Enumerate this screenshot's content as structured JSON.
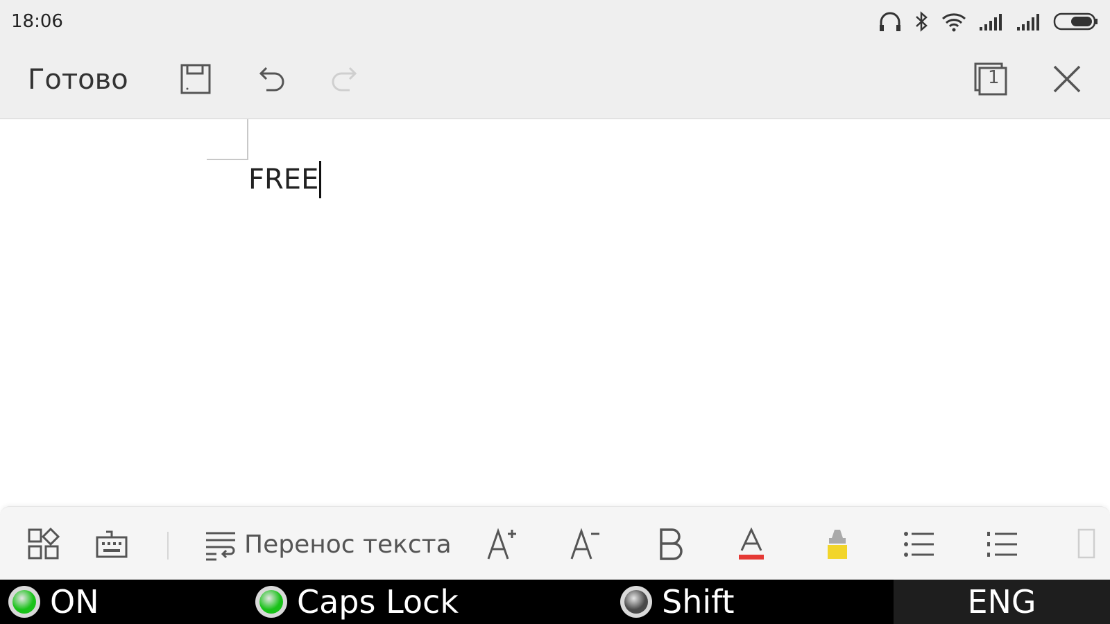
{
  "status_bar": {
    "time": "18:06",
    "icons": [
      "headphones-icon",
      "bluetooth-icon",
      "wifi-icon",
      "signal-icon",
      "signal-icon",
      "battery-icon"
    ]
  },
  "toolbar": {
    "done_label": "Готово",
    "page_number": "1"
  },
  "document": {
    "text": "FREE"
  },
  "format_bar": {
    "wrap_label": "Перенос текста",
    "text_color": "#e53935",
    "highlight_color": "#f2d52a"
  },
  "indicators": {
    "items": [
      {
        "label": "ON",
        "state": "active",
        "color": "#19c219"
      },
      {
        "label": "Caps Lock",
        "state": "active",
        "color": "#19c219"
      },
      {
        "label": "Shift",
        "state": "inactive",
        "color": "#4a4a4a"
      }
    ],
    "language": "ENG"
  }
}
